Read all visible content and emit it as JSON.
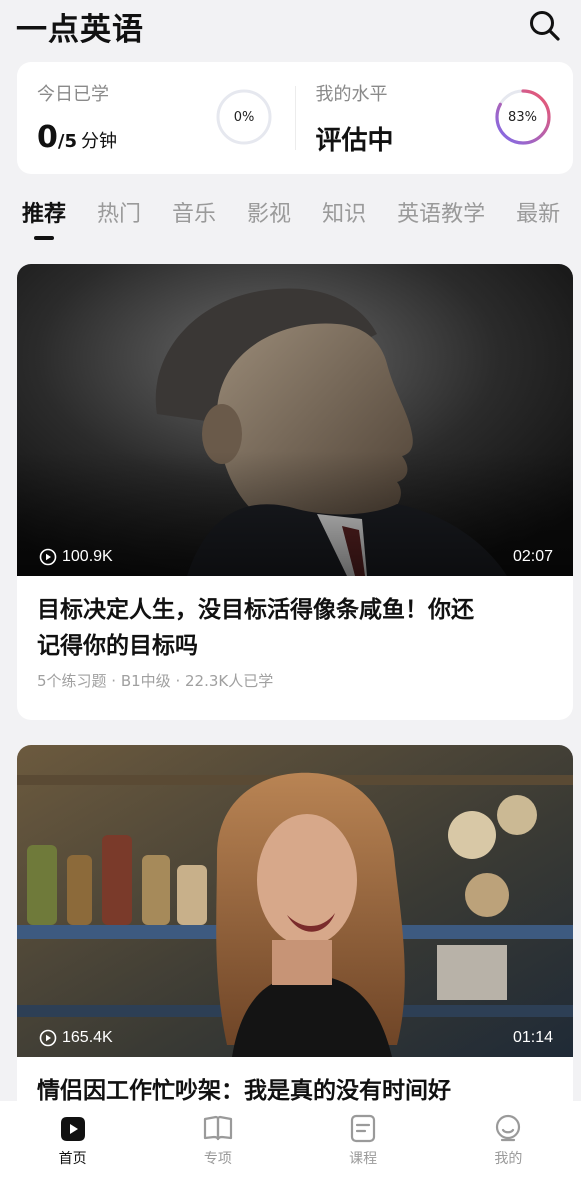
{
  "app": {
    "title": "一点英语"
  },
  "stats": {
    "today": {
      "label": "今日已学",
      "value": "0",
      "goal": "/5",
      "unit": "分钟",
      "ring_percent_text": "0%",
      "ring_percent": 0
    },
    "level": {
      "label": "我的水平",
      "value": "评估中",
      "ring_percent_text": "83%",
      "ring_percent": 83
    }
  },
  "tabs": [
    {
      "label": "推荐",
      "active": true
    },
    {
      "label": "热门"
    },
    {
      "label": "音乐"
    },
    {
      "label": "影视"
    },
    {
      "label": "知识"
    },
    {
      "label": "英语教学"
    },
    {
      "label": "最新"
    }
  ],
  "videos": [
    {
      "views": "100.9K",
      "duration": "02:07",
      "title_line1": "目标决定人生，没目标活得像条咸鱼！你还",
      "title_line2": "记得你的目标吗",
      "meta": "5个练习题 · B1中级 · 22.3K人已学"
    },
    {
      "views": "165.4K",
      "duration": "01:14",
      "title_line1": "情侣因工作忙吵架：我是真的没有时间好"
    }
  ],
  "nav": [
    {
      "label": "首页",
      "icon": "home-play-icon",
      "active": true
    },
    {
      "label": "专项",
      "icon": "book-icon"
    },
    {
      "label": "课程",
      "icon": "course-icon"
    },
    {
      "label": "我的",
      "icon": "profile-icon"
    }
  ],
  "colors": {
    "accent_ring_start": "#7b6cf0",
    "accent_ring_end": "#f0566a",
    "ring_track": "#e6e8ef"
  }
}
